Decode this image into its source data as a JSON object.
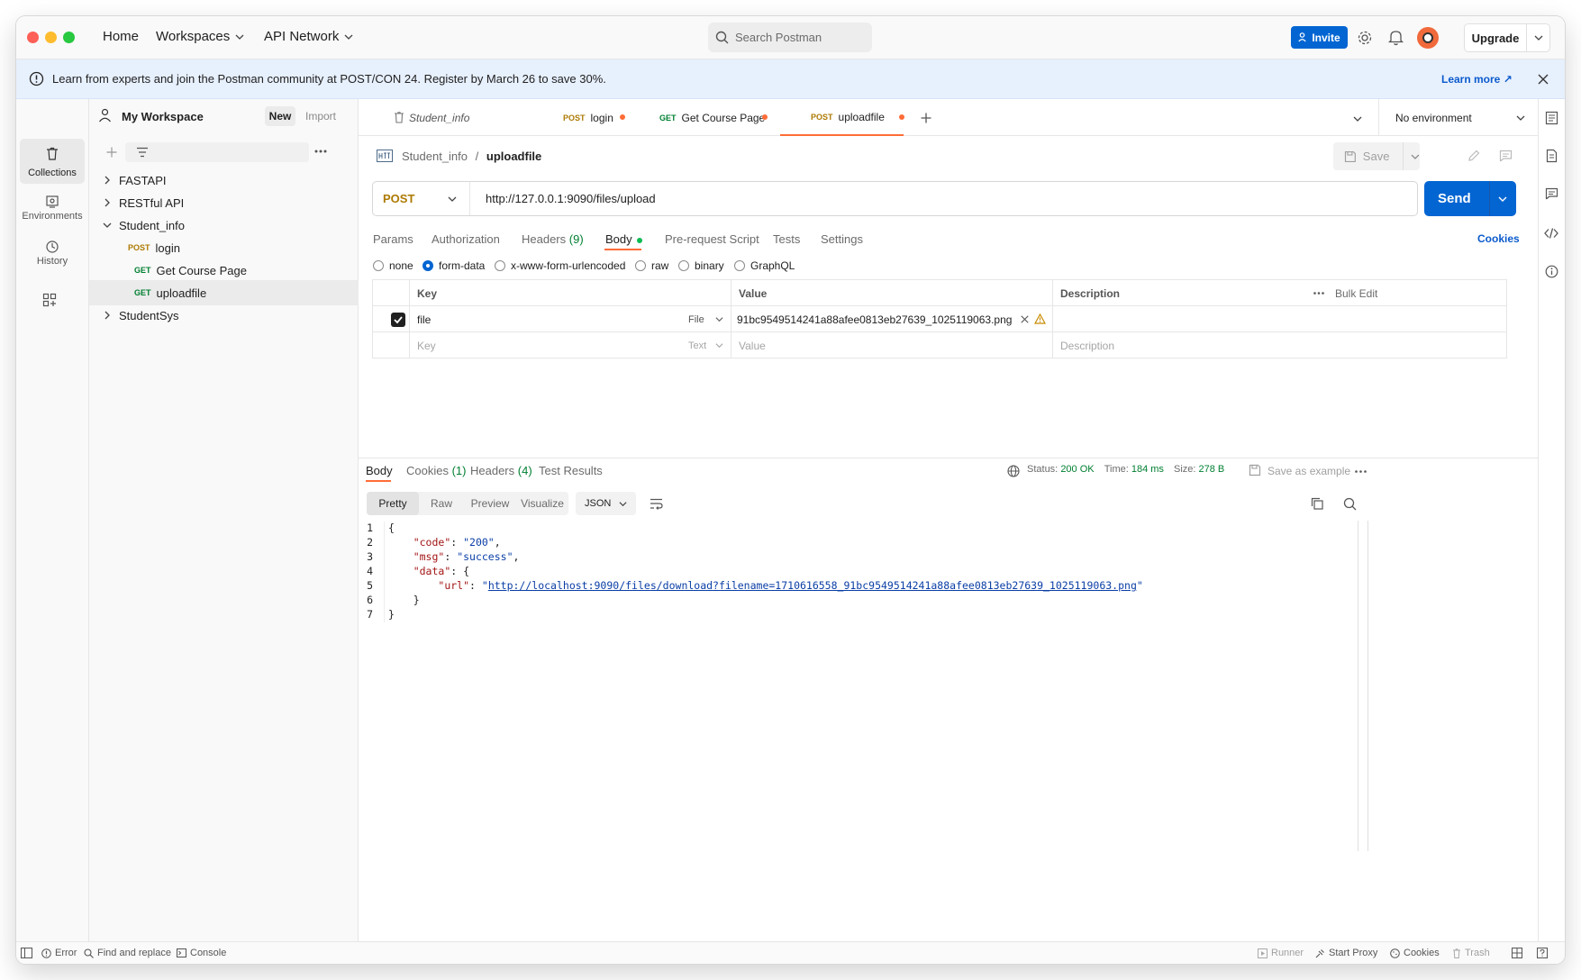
{
  "colors": {
    "accent": "#0265d2",
    "get": "#007f31",
    "post": "#ad7a03",
    "modified": "#ff6c37",
    "link": "#0b5bcc"
  },
  "titlebar": {
    "home": "Home",
    "workspaces": "Workspaces",
    "api_network": "API Network",
    "search_placeholder": "Search Postman",
    "invite": "Invite",
    "upgrade": "Upgrade"
  },
  "banner": {
    "text": "Learn from experts and join the Postman community at POST/CON 24. Register by March 26 to save 30%.",
    "learn_more": "Learn more ↗"
  },
  "rail": {
    "collections": "Collections",
    "environments": "Environments",
    "history": "History"
  },
  "sidebar": {
    "workspace": "My Workspace",
    "new": "New",
    "import": "Import",
    "tree": [
      {
        "label": "FASTAPI"
      },
      {
        "label": "RESTful API"
      },
      {
        "label": "Student_info"
      },
      {
        "method": "POST",
        "label": "login"
      },
      {
        "method": "GET",
        "label": "Get Course Page"
      },
      {
        "method": "GET",
        "label": "uploadfile"
      },
      {
        "label": "StudentSys"
      }
    ]
  },
  "tabs": [
    {
      "label": "Student_info"
    },
    {
      "method": "POST",
      "label": "login"
    },
    {
      "method": "GET",
      "label": "Get Course Page"
    },
    {
      "method": "POST",
      "label": "uploadfile"
    }
  ],
  "environment": "No environment",
  "request": {
    "breadcrumb_parent": "Student_info",
    "breadcrumb_sep": "/",
    "breadcrumb_current": "uploadfile",
    "save": "Save",
    "method": "POST",
    "url": "http://127.0.0.1:9090/files/upload",
    "send": "Send",
    "tabs": {
      "params": "Params",
      "authorization": "Authorization",
      "headers": "Headers",
      "headers_count": "(9)",
      "body": "Body",
      "prerequest": "Pre-request Script",
      "tests": "Tests",
      "settings": "Settings"
    },
    "cookies": "Cookies",
    "body_types": [
      "none",
      "form-data",
      "x-www-form-urlencoded",
      "raw",
      "binary",
      "GraphQL"
    ],
    "body_type_selected": "form-data",
    "table": {
      "headers": {
        "key": "Key",
        "value": "Value",
        "description": "Description",
        "bulk_edit": "Bulk Edit"
      },
      "row": {
        "key": "file",
        "type": "File",
        "value": "91bc9549514241a88afee0813eb27639_1025119063.png"
      },
      "placeholder": {
        "key": "Key",
        "type": "Text",
        "value": "Value",
        "description": "Description"
      }
    }
  },
  "response": {
    "tabs": {
      "body": "Body",
      "cookies": "Cookies",
      "cookies_count": "(1)",
      "headers": "Headers",
      "headers_count": "(4)",
      "test_results": "Test Results"
    },
    "status_label": "Status:",
    "status": "200 OK",
    "time_label": "Time:",
    "time": "184 ms",
    "size_label": "Size:",
    "size": "278 B",
    "save_example": "Save as example",
    "views": [
      "Pretty",
      "Raw",
      "Preview",
      "Visualize"
    ],
    "format": "JSON",
    "json": {
      "code_key": "\"code\"",
      "code_val": "\"200\"",
      "msg_key": "\"msg\"",
      "msg_val": "\"success\"",
      "data_key": "\"data\"",
      "url_key": "\"url\"",
      "url_val": "http://localhost:9090/files/download?filename=1710616558_91bc9549514241a88afee0813eb27639_1025119063.png"
    }
  },
  "statusbar": {
    "error": "Error",
    "find_replace": "Find and replace",
    "console": "Console",
    "runner": "Runner",
    "start_proxy": "Start Proxy",
    "cookies": "Cookies",
    "trash": "Trash"
  }
}
